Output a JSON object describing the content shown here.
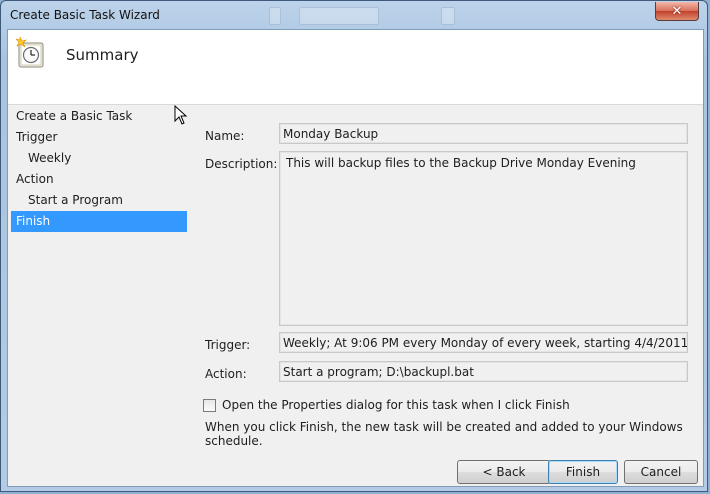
{
  "window": {
    "title": "Create Basic Task Wizard",
    "close_glyph": "✕"
  },
  "header": {
    "title": "Summary",
    "icon": "scheduled-task-clock-icon"
  },
  "nav": {
    "items": [
      {
        "label": "Create a Basic Task",
        "sub": false,
        "selected": false
      },
      {
        "label": "Trigger",
        "sub": false,
        "selected": false
      },
      {
        "label": "Weekly",
        "sub": true,
        "selected": false
      },
      {
        "label": "Action",
        "sub": false,
        "selected": false
      },
      {
        "label": "Start a Program",
        "sub": true,
        "selected": false
      },
      {
        "label": "Finish",
        "sub": false,
        "selected": true
      }
    ]
  },
  "summary": {
    "name_label": "Name:",
    "name_value": "Monday Backup",
    "description_label": "Description:",
    "description_value": "This will backup files to the Backup Drive Monday Evening",
    "trigger_label": "Trigger:",
    "trigger_value": "Weekly; At 9:06 PM every Monday of every week, starting 4/4/2011",
    "action_label": "Action:",
    "action_value": "Start a program; D:\\backupl.bat"
  },
  "options": {
    "open_properties_label": "Open the Properties dialog for this task when I click Finish",
    "open_properties_checked": false,
    "finish_note": "When you click Finish, the new task will be created and added to your Windows schedule."
  },
  "buttons": {
    "back": "< Back",
    "finish": "Finish",
    "cancel": "Cancel"
  },
  "colors": {
    "selection": "#3399ff",
    "titlebar": "#bcd3ea"
  }
}
